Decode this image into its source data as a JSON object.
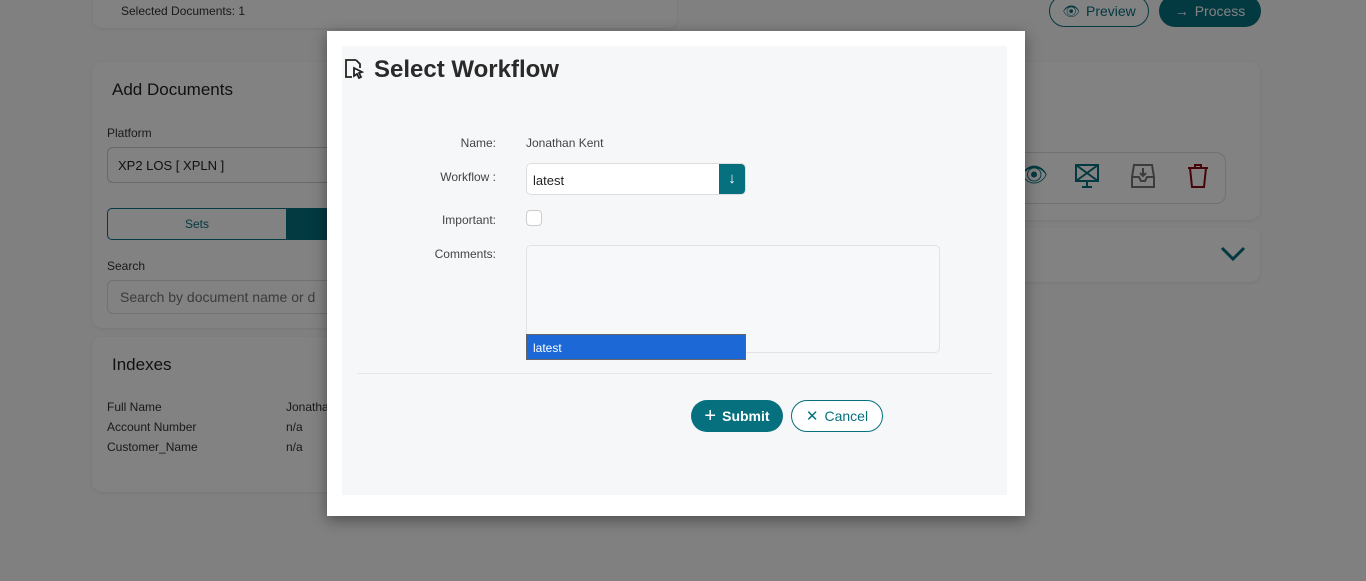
{
  "background": {
    "selected_documents": "Selected Documents: 1",
    "preview_label": "Preview",
    "process_label": "Process",
    "add_documents": {
      "title": "Add Documents",
      "platform_label": "Platform",
      "platform_value": "XP2 LOS [ XPLN ]",
      "tab_sets": "Sets",
      "search_label": "Search",
      "search_placeholder": "Search by document name or d"
    },
    "indexes": {
      "title": "Indexes",
      "rows": [
        {
          "key": "Full Name",
          "value": "Jonatha"
        },
        {
          "key": "Account Number",
          "value": "n/a"
        },
        {
          "key": "Customer_Name",
          "value": "n/a"
        }
      ]
    },
    "colors": {
      "accent": "#07707f",
      "delete": "#8b0a12"
    }
  },
  "modal": {
    "title": "Select Workflow",
    "name_label": "Name:",
    "name_value": "Jonathan Kent",
    "workflow_label": "Workflow :",
    "workflow_value": "latest",
    "important_label": "Important:",
    "comments_label": "Comments:",
    "comments_value": "",
    "dropdown_options": [
      "latest"
    ],
    "submit_label": "Submit",
    "cancel_label": "Cancel",
    "colors": {
      "accent": "#07707f",
      "option_highlight": "#1b68d6"
    }
  }
}
